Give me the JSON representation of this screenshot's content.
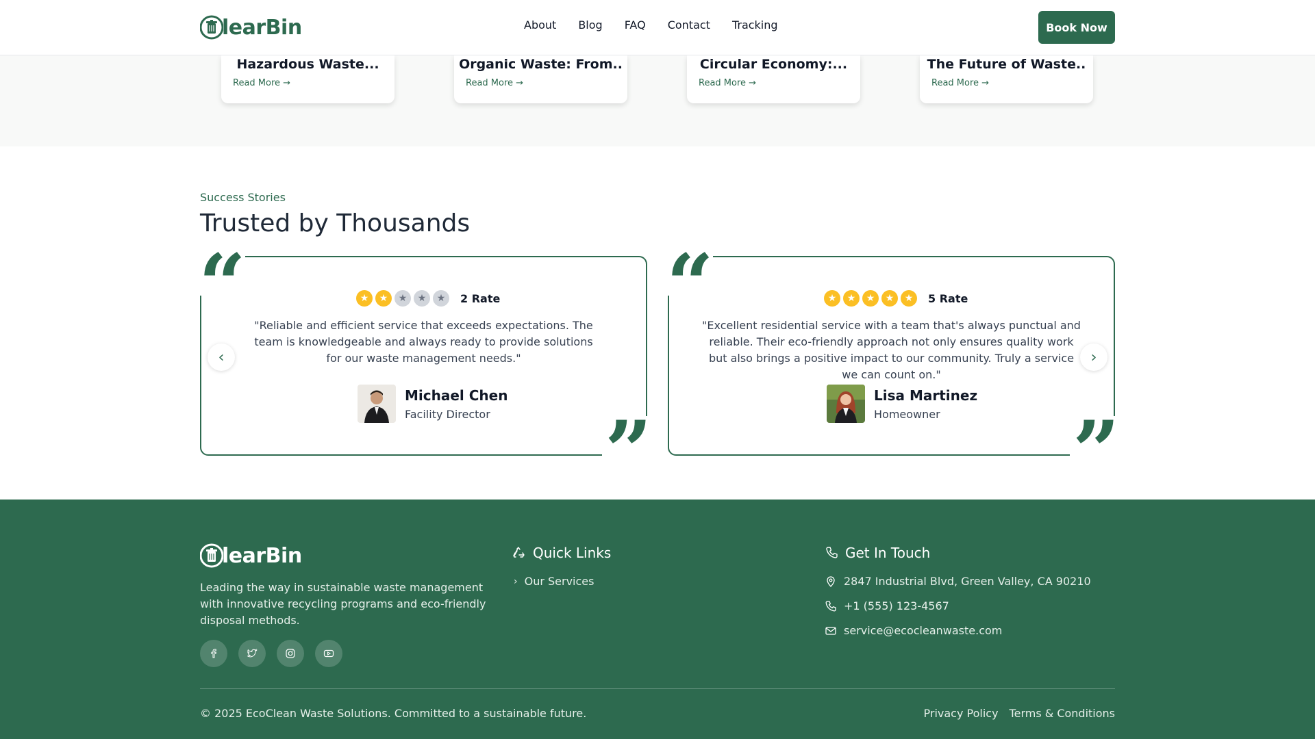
{
  "header": {
    "logo_text": "learBin",
    "nav": [
      "About",
      "Blog",
      "FAQ",
      "Contact",
      "Tracking"
    ],
    "cta": "Book Now"
  },
  "blog": {
    "cards": [
      {
        "title": "Hazardous Waste...",
        "more": "Read More →"
      },
      {
        "title": "Organic Waste: From..",
        "more": "Read More →"
      },
      {
        "title": "Circular Economy:...",
        "more": "Read More →"
      },
      {
        "title": "The Future of Waste..",
        "more": "Read More →"
      }
    ]
  },
  "testimonials": {
    "eyebrow": "Success Stories",
    "title": "Trusted by Thousands",
    "items": [
      {
        "rating": 2,
        "rate_label": "2 Rate",
        "quote": "\"Reliable and efficient service that exceeds expectations. The team is knowledgeable and always ready to provide solutions for our waste management needs.\"",
        "name": "Michael Chen",
        "role": "Facility Director"
      },
      {
        "rating": 5,
        "rate_label": "5 Rate",
        "quote": "\"Excellent residential service with a team that's always punctual and reliable. Their eco-friendly approach not only ensures quality work but also brings a positive impact to our community. Truly a service we can count on.\"",
        "name": "Lisa Martinez",
        "role": "Homeowner"
      }
    ]
  },
  "footer": {
    "logo_text": "learBin",
    "description": "Leading the way in sustainable waste management with innovative recycling programs and eco-friendly disposal methods.",
    "socials": [
      "facebook-icon",
      "twitter-icon",
      "instagram-icon",
      "youtube-icon"
    ],
    "quick_links_title": "Quick Links",
    "quick_links": [
      "Our Services"
    ],
    "contact_title": "Get In Touch",
    "address": "2847 Industrial Blvd, Green Valley, CA 90210",
    "phone": "+1 (555) 123-4567",
    "email": "service@ecocleanwaste.com",
    "copyright": "© 2025 EcoClean Waste Solutions. Committed to a sustainable future.",
    "privacy": "Privacy Policy",
    "terms": "Terms & Conditions"
  },
  "colors": {
    "brand": "#2d6a4f",
    "star": "#fbbf24"
  }
}
